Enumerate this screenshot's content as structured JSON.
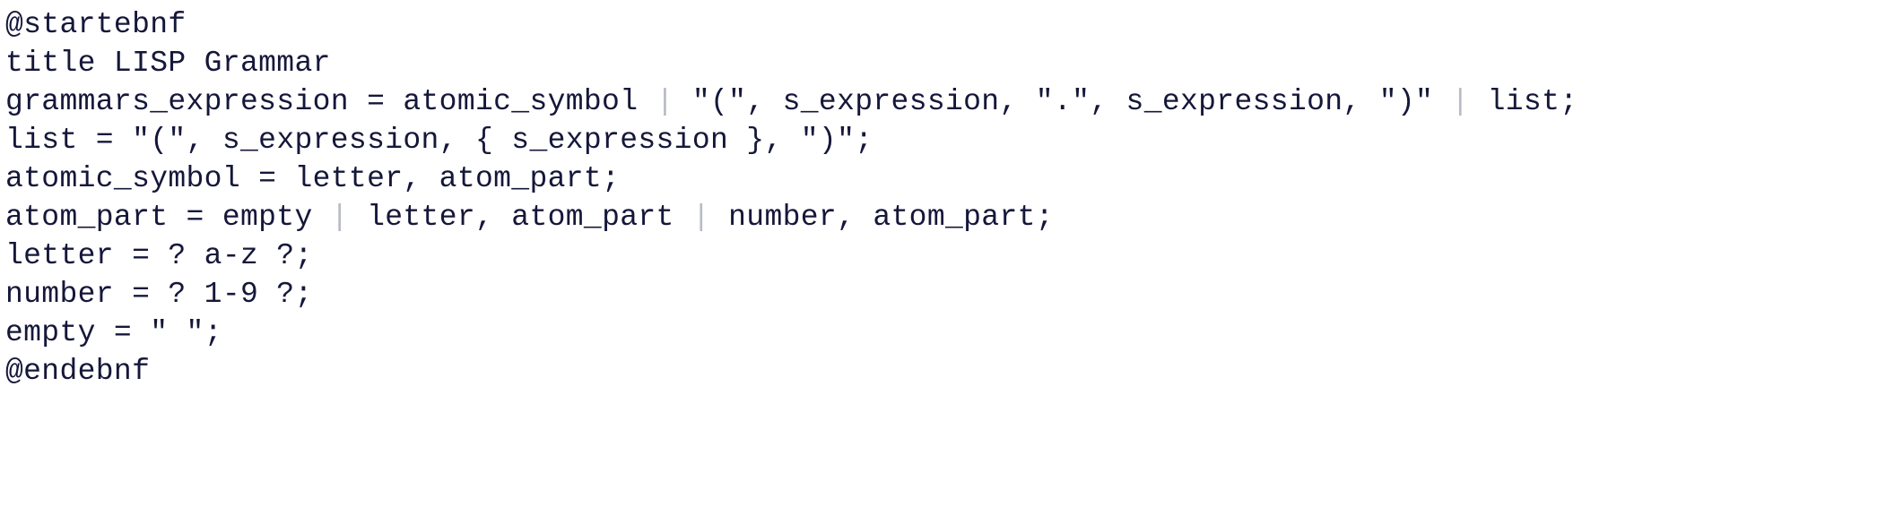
{
  "document": {
    "kind": "plantuml-ebnf-source",
    "background_color": "#ffffff",
    "text_color": "#15173a",
    "pipe_color": "#b9bcc6",
    "title_directive": "title LISP Grammar",
    "start_directive": "@startebnf",
    "end_directive": "@endebnf"
  },
  "lines": [
    {
      "number": 1,
      "text": "@startebnf",
      "tokens": [
        {
          "t": "@startebnf",
          "k": "plain"
        }
      ]
    },
    {
      "number": 2,
      "text": "title LISP Grammar",
      "tokens": [
        {
          "t": "title LISP Grammar",
          "k": "plain"
        }
      ]
    },
    {
      "number": 3,
      "text": "grammars_expression = atomic_symbol | ″(″, s_expression, ″.″, s_expression, ″)″ | list;",
      "tokens": [
        {
          "t": "grammars_expression = atomic_symbol ",
          "k": "plain"
        },
        {
          "t": "|",
          "k": "pipe"
        },
        {
          "t": " ",
          "k": "plain"
        },
        {
          "t": "″(″",
          "k": "quote"
        },
        {
          "t": ", s_expression, ",
          "k": "plain"
        },
        {
          "t": "″.″",
          "k": "quote"
        },
        {
          "t": ", s_expression, ",
          "k": "plain"
        },
        {
          "t": "″)″",
          "k": "quote"
        },
        {
          "t": " ",
          "k": "plain"
        },
        {
          "t": "|",
          "k": "pipe"
        },
        {
          "t": " list;",
          "k": "plain"
        }
      ]
    },
    {
      "number": 4,
      "text": "list = ″(″, s_expression, { s_expression }, ″)″;",
      "tokens": [
        {
          "t": "list = ",
          "k": "plain"
        },
        {
          "t": "″(″",
          "k": "quote"
        },
        {
          "t": ", s_expression, { s_expression }, ",
          "k": "plain"
        },
        {
          "t": "″)″",
          "k": "quote"
        },
        {
          "t": ";",
          "k": "plain"
        }
      ]
    },
    {
      "number": 5,
      "text": "atomic_symbol = letter, atom_part;",
      "tokens": [
        {
          "t": "atomic_symbol = letter, atom_part;",
          "k": "plain"
        }
      ]
    },
    {
      "number": 6,
      "text": "atom_part = empty | letter, atom_part | number, atom_part;",
      "tokens": [
        {
          "t": "atom_part = empty ",
          "k": "plain"
        },
        {
          "t": "|",
          "k": "pipe"
        },
        {
          "t": " letter, atom_part ",
          "k": "plain"
        },
        {
          "t": "|",
          "k": "pipe"
        },
        {
          "t": " number, atom_part;",
          "k": "plain"
        }
      ]
    },
    {
      "number": 7,
      "text": "letter = ? a-z ?;",
      "tokens": [
        {
          "t": "letter = ? a-z ?;",
          "k": "plain"
        }
      ]
    },
    {
      "number": 8,
      "text": "number = ? 1-9 ?;",
      "tokens": [
        {
          "t": "number = ? 1-9 ?;",
          "k": "plain"
        }
      ]
    },
    {
      "number": 9,
      "text": "empty = ″ ″;",
      "tokens": [
        {
          "t": "empty = ",
          "k": "plain"
        },
        {
          "t": "″ ″",
          "k": "quote"
        },
        {
          "t": ";",
          "k": "plain"
        }
      ]
    },
    {
      "number": 10,
      "text": "@endebnf",
      "tokens": [
        {
          "t": "@endebnf",
          "k": "plain"
        }
      ]
    }
  ]
}
